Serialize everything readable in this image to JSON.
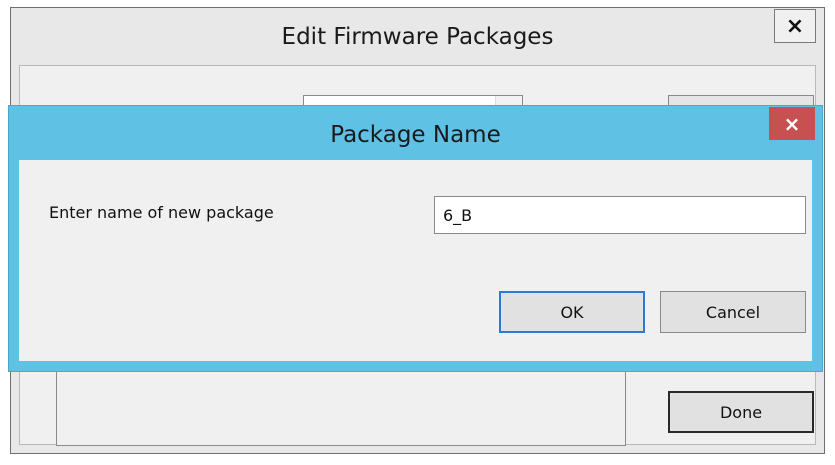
{
  "parent_dialog": {
    "title": "Edit Firmware Packages",
    "close_glyph": "×",
    "done_label": "Done"
  },
  "modal_dialog": {
    "title": "Package Name",
    "close_glyph": "×",
    "prompt_label": "Enter name of new package",
    "name_value": "6_B",
    "ok_label": "OK",
    "cancel_label": "Cancel"
  },
  "colors": {
    "modal_frame": "#5fc2e5",
    "modal_close": "#c75050",
    "dialog_bg": "#f0f0f0"
  },
  "icons": [
    "close-icon",
    "chevron-down-icon"
  ]
}
